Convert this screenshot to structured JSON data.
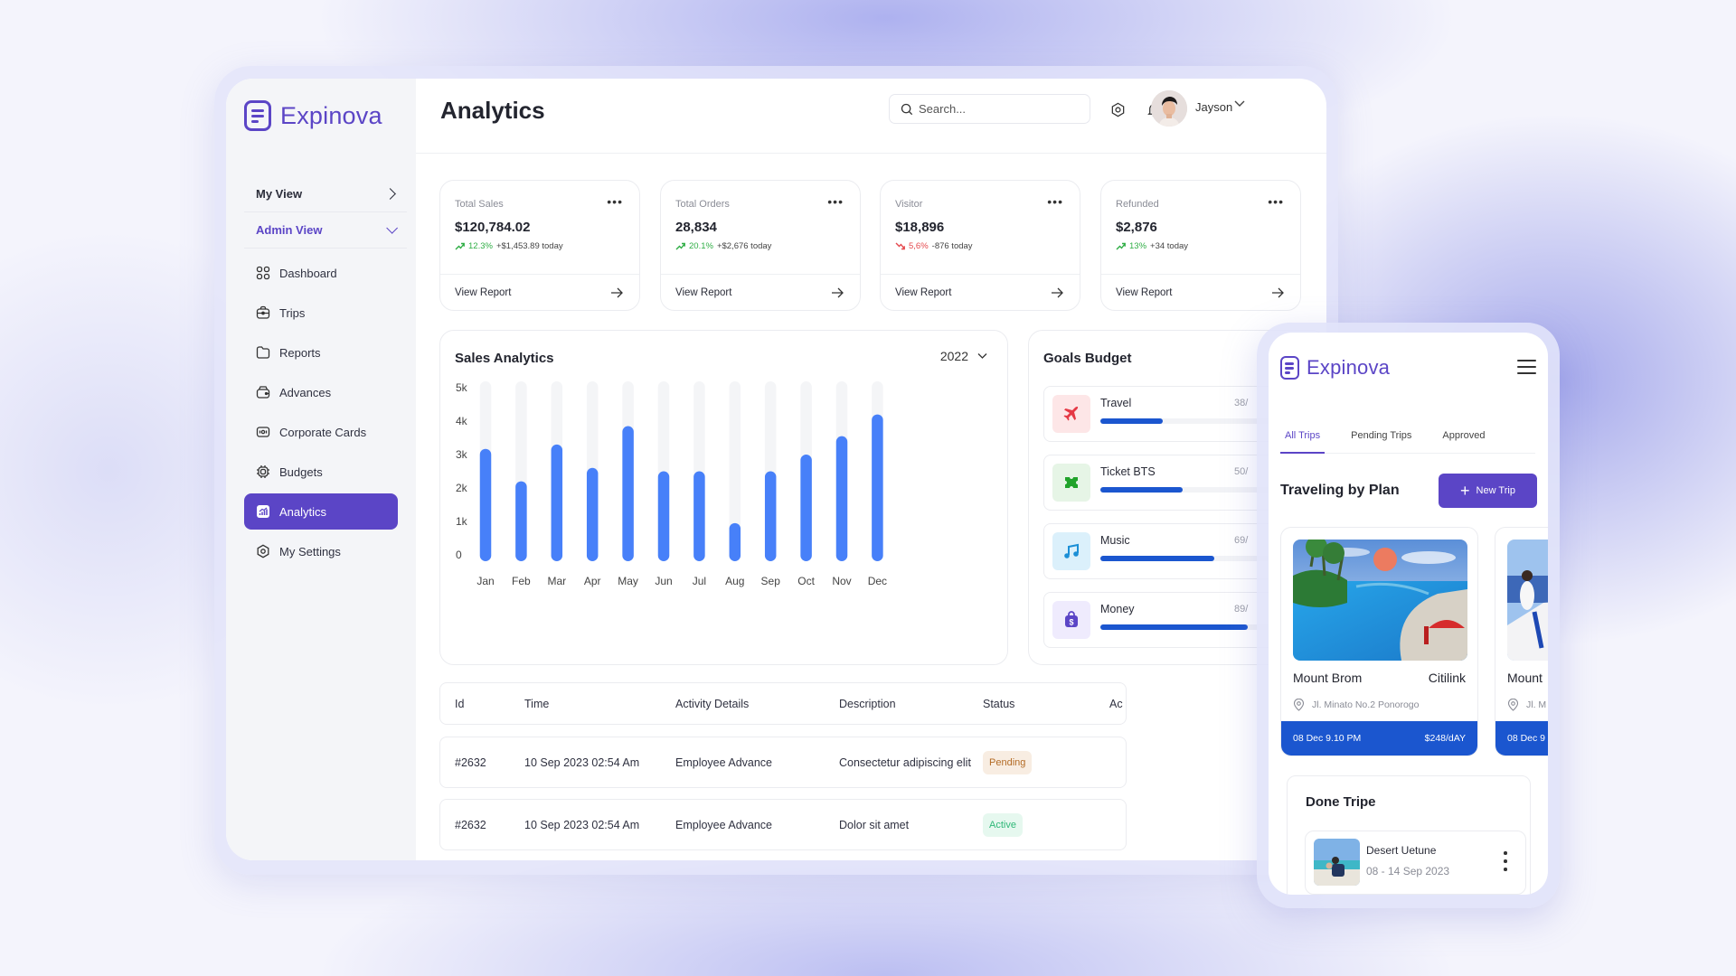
{
  "app": {
    "name": "Expinova"
  },
  "sidebar": {
    "views": [
      {
        "label": "My View",
        "state": "collapsed"
      },
      {
        "label": "Admin View",
        "state": "expanded"
      }
    ],
    "items": [
      {
        "label": "Dashboard",
        "icon": "grid-icon"
      },
      {
        "label": "Trips",
        "icon": "briefcase-icon"
      },
      {
        "label": "Reports",
        "icon": "folder-icon"
      },
      {
        "label": "Advances",
        "icon": "wallet-icon"
      },
      {
        "label": "Corporate Cards",
        "icon": "card-icon"
      },
      {
        "label": "Budgets",
        "icon": "chip-icon"
      },
      {
        "label": "Analytics",
        "icon": "chart-icon",
        "active": true
      },
      {
        "label": "My Settings",
        "icon": "settings-icon"
      }
    ]
  },
  "header": {
    "title": "Analytics",
    "search_placeholder": "Search...",
    "user_name": "Jayson"
  },
  "stats": [
    {
      "label": "Total Sales",
      "value": "$120,784.02",
      "pct": "12.3%",
      "trend": "up",
      "today": "+$1,453.89 today",
      "link": "View Report"
    },
    {
      "label": "Total Orders",
      "value": "28,834",
      "pct": "20.1%",
      "trend": "up",
      "today": "+$2,676 today",
      "link": "View Report"
    },
    {
      "label": "Visitor",
      "value": "$18,896",
      "pct": "5,6%",
      "trend": "down",
      "today": "-876 today",
      "link": "View Report"
    },
    {
      "label": "Refunded",
      "value": "$2,876",
      "pct": "13%",
      "trend": "up",
      "today": "+34 today",
      "link": "View Report"
    }
  ],
  "sales_analytics": {
    "title": "Sales Analytics",
    "year": "2022"
  },
  "chart_data": {
    "type": "bar",
    "title": "Sales Analytics",
    "xlabel": "",
    "ylabel": "",
    "categories": [
      "Jan",
      "Feb",
      "Mar",
      "Apr",
      "May",
      "Jun",
      "Jul",
      "Aug",
      "Sep",
      "Oct",
      "Nov",
      "Dec"
    ],
    "values": [
      3170,
      2200,
      3300,
      2600,
      3850,
      2500,
      2500,
      950,
      2500,
      3000,
      3550,
      4200
    ],
    "ylim": [
      0,
      5000
    ],
    "yticks": [
      0,
      1000,
      2000,
      3000,
      4000,
      5000
    ],
    "ytick_labels": [
      "0",
      "1k",
      "2k",
      "3k",
      "4k",
      "5k"
    ],
    "grid": false,
    "bar_color": "#4780f9",
    "track_color": "#f4f5f7"
  },
  "goals": {
    "title": "Goals Budget",
    "items": [
      {
        "name": "Travel",
        "value_text": "38/",
        "progress": 0.38,
        "icon": "airplane-icon",
        "bg": "#fde6e7",
        "fg": "#e53945"
      },
      {
        "name": "Ticket BTS",
        "value_text": "50/",
        "progress": 0.5,
        "icon": "ticket-icon",
        "bg": "#e6f5e6",
        "fg": "#21a32b"
      },
      {
        "name": "Music",
        "value_text": "69/",
        "progress": 0.69,
        "icon": "music-note-icon",
        "bg": "#dbf0fb",
        "fg": "#1b8fd6"
      },
      {
        "name": "Money",
        "value_text": "89/",
        "progress": 0.89,
        "icon": "money-bag-icon",
        "bg": "#efebfd",
        "fg": "#5b45c6"
      }
    ]
  },
  "table": {
    "columns": [
      "Id",
      "Time",
      "Activity Details",
      "Description",
      "Status",
      "Ac"
    ],
    "rows": [
      {
        "id": "#2632",
        "time": "10 Sep 2023 02:54 Am",
        "activity": "Employee Advance",
        "description": "Consectetur adipiscing elit",
        "status": "Pending"
      },
      {
        "id": "#2632",
        "time": "10 Sep 2023 02:54 Am",
        "activity": "Employee Advance",
        "description": "Dolor sit amet",
        "status": "Active"
      }
    ]
  },
  "mobile": {
    "tabs": [
      "All Trips",
      "Pending Trips",
      "Approved"
    ],
    "active_tab": 0,
    "plan_title": "Traveling by Plan",
    "new_trip_label": "New Trip",
    "trips": [
      {
        "name": "Mount Brom",
        "carrier": "Citilink",
        "address": "Jl. Minato No.2 Ponorogo",
        "date": "08 Dec  9.10 PM",
        "price": "$248/dAY"
      },
      {
        "name": "Mount",
        "carrier": "",
        "address": "Jl. M",
        "date": "08 Dec  9",
        "price": ""
      }
    ],
    "done_title": "Done Tripe",
    "done_items": [
      {
        "name": "Desert Uetune",
        "dates": "08 - 14 Sep 2023"
      }
    ]
  },
  "colors": {
    "brand": "#5b45c6",
    "bar": "#4780f9",
    "trip_bar": "#1b56cf",
    "up": "#2fae45",
    "down": "#e5484d"
  }
}
